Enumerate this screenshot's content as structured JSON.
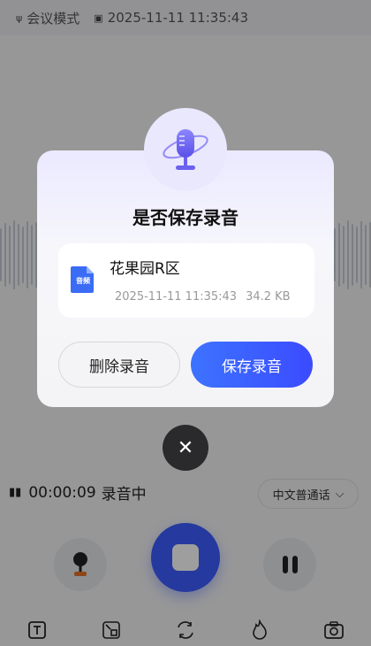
{
  "topbar": {
    "mode_icon": "mic-mode-icon",
    "mode_label": "会议模式",
    "date_icon": "calendar-icon",
    "datetime": "2025-11-11 11:35:43"
  },
  "recording": {
    "status_icon": "pause-indicator-icon",
    "time": "00:00:09",
    "state": "录音中",
    "language": "中文普通话",
    "language_chevron": "⌵"
  },
  "toolbar": {
    "items": [
      {
        "name": "text-icon",
        "glyph": "T"
      },
      {
        "name": "edit-frame-icon",
        "glyph": "⧉"
      },
      {
        "name": "translate-icon",
        "glyph": "⇆"
      },
      {
        "name": "flame-icon",
        "glyph": "♨"
      },
      {
        "name": "camera-icon",
        "glyph": "◉"
      }
    ]
  },
  "dialog": {
    "title": "是否保存录音",
    "file_name": "花果园R区",
    "file_icon_label": "音频",
    "file_datetime": "2025-11-11 11:35:43",
    "file_size": "34.2 KB",
    "delete_label": "删除录音",
    "save_label": "保存录音",
    "close_glyph": "✕"
  },
  "colors": {
    "accent": "#3d5cff",
    "save_gradient_start": "#3d73ff",
    "file_icon": "#3a6cf5"
  }
}
